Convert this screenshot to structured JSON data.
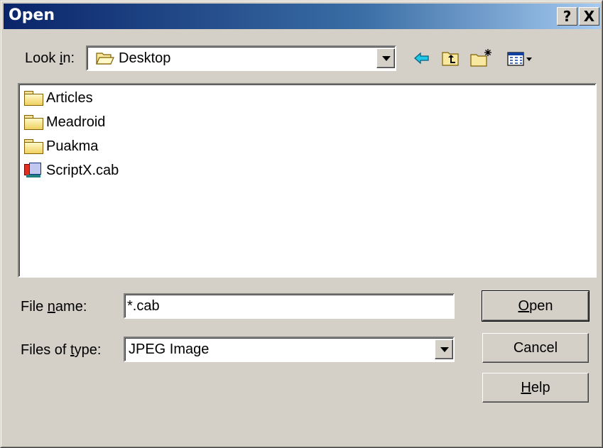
{
  "window": {
    "title": "Open",
    "help_button": "?",
    "close_button": "X"
  },
  "look_in": {
    "label_prefix": "Look ",
    "label_mnemonic": "i",
    "label_suffix": "n:",
    "value": "Desktop"
  },
  "toolbar": {
    "icons": [
      "back-arrow-icon",
      "up-one-level-icon",
      "create-new-folder-icon",
      "view-menu-icon"
    ]
  },
  "files": [
    {
      "name": "Articles",
      "icon": "folder-icon"
    },
    {
      "name": "Meadroid",
      "icon": "folder-icon"
    },
    {
      "name": "Puakma",
      "icon": "folder-icon"
    },
    {
      "name": "ScriptX.cab",
      "icon": "cab-file-icon"
    }
  ],
  "file_name": {
    "label_prefix": "File ",
    "label_mnemonic": "n",
    "label_suffix": "ame:",
    "value": "*.cab"
  },
  "files_of_type": {
    "label_prefix": "Files of ",
    "label_mnemonic": "t",
    "label_suffix": "ype:",
    "value": "JPEG Image"
  },
  "buttons": {
    "open_mnemonic": "O",
    "open_rest": "pen",
    "cancel": "Cancel",
    "help_mnemonic": "H",
    "help_rest": "elp"
  },
  "colors": {
    "dialog_bg": "#d4d0c8",
    "title_start": "#0a246a",
    "title_end": "#a6caf0"
  }
}
